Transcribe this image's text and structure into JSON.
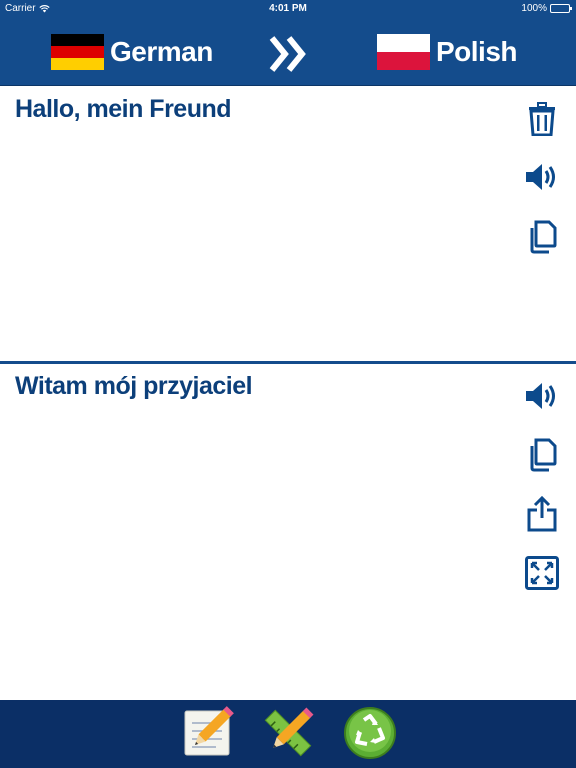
{
  "status": {
    "carrier": "Carrier",
    "time": "4:01 PM",
    "battery": "100%"
  },
  "languages": {
    "source": {
      "label": "German",
      "flag": [
        "#000000",
        "#dd0000",
        "#ffce00"
      ]
    },
    "target": {
      "label": "Polish",
      "flag": [
        "#ffffff",
        "#dc143c"
      ]
    },
    "swap_icon": "double-chevron-right-icon"
  },
  "source_panel": {
    "text": "Hallo, mein Freund",
    "actions": [
      "trash-icon",
      "speaker-icon",
      "copy-icon"
    ]
  },
  "target_panel": {
    "text": "Witam mój przyjaciel",
    "actions": [
      "speaker-icon",
      "copy-icon",
      "share-icon",
      "fullscreen-icon"
    ]
  },
  "toolbar": {
    "items": [
      "notepad-pencil-icon",
      "pencil-ruler-icon",
      "recycle-icon"
    ]
  },
  "colors": {
    "header": "#144c8c",
    "toolbar": "#0b2f66",
    "text": "#0c3f7a",
    "icon": "#0c4a8c"
  }
}
